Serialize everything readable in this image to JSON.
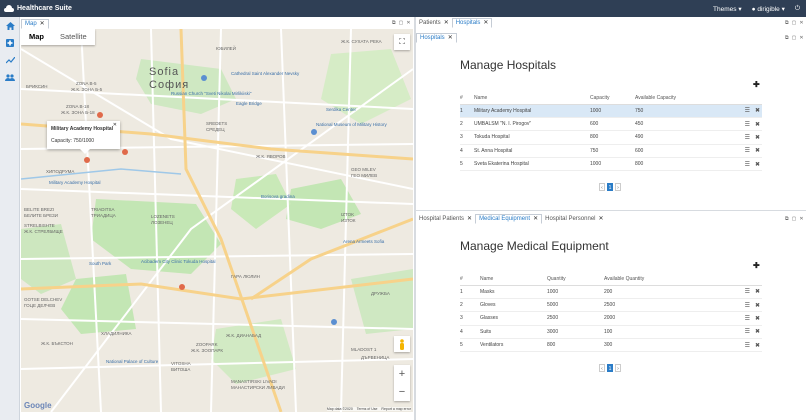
{
  "app": {
    "title": "Healthcare Suite",
    "themes": "Themes",
    "user": "dirigible"
  },
  "sidebar": {
    "icons": [
      "home-icon",
      "hospital-icon",
      "chart-icon",
      "people-icon"
    ]
  },
  "map_tabs": [
    {
      "label": "Map"
    }
  ],
  "map": {
    "type_buttons": [
      "Map",
      "Satellite"
    ],
    "info_title": "Military Academy Hospital",
    "info_capacity": "Capacity: 750/1000",
    "city_latin": "Sofia",
    "city_cyr": "София",
    "google": "Google",
    "attr": [
      "Map data ©2020",
      "Terms of Use",
      "Report a map error"
    ],
    "labels": [
      {
        "t": "ZONA B-5"
      },
      {
        "t": "Ж.К. ЗОНА Б-5"
      },
      {
        "t": "ZONA B-18"
      },
      {
        "t": "Ж.К. ЗОНА Б-18"
      },
      {
        "t": "ЮБИЛЕЙ"
      },
      {
        "t": "SREDETS"
      },
      {
        "t": "СРЕДЕЦ"
      },
      {
        "t": "IZTOK"
      },
      {
        "t": "ИЗТОК"
      },
      {
        "t": "LOZENETS"
      },
      {
        "t": "ЛОЗЕНЕЦ"
      },
      {
        "t": "ГАРА ЛЮЛИН"
      },
      {
        "t": "TRIADITSA"
      },
      {
        "t": "ТРИАДИЦА"
      },
      {
        "t": "STRELBISHTE"
      },
      {
        "t": "Ж.К. СТРЕЛБИЩЕ"
      },
      {
        "t": "GOTSE DELCHEV"
      },
      {
        "t": "ГОЦЕ ДЕЛЧЕВ"
      },
      {
        "t": "Ж.К. ДИАНАБАД"
      },
      {
        "t": "ZOOPARK"
      },
      {
        "t": "Ж.К. ЗООПАРК"
      },
      {
        "t": "VITOSHA"
      },
      {
        "t": "ВИТОША"
      },
      {
        "t": "MANASTIRSKI LIVADI"
      },
      {
        "t": "МАНАСТИРСКИ ЛИВАДИ"
      },
      {
        "t": "MLADOST 1"
      },
      {
        "t": "GEO MILEV"
      },
      {
        "t": "ГЕО МИЛЕВ"
      },
      {
        "t": "Ж.К. СУХАТА РЕКА"
      },
      {
        "t": "Ж.К. ЯВОРОВ"
      },
      {
        "t": "BELITE BREZI"
      },
      {
        "t": "БЕЛИТЕ БРЕЗИ"
      },
      {
        "t": "ХИПОДРУМА"
      },
      {
        "t": "БРИКСИН"
      },
      {
        "t": "ДРУЖБА"
      },
      {
        "t": "Ж.К. БЪКСТОН"
      },
      {
        "t": "ХЛАДИЛНИКА"
      },
      {
        "t": "ДЪРВЕНИЦА"
      }
    ],
    "pois": [
      {
        "t": "Cathedral Saint Alexander Nevsky"
      },
      {
        "t": "Russian Church \"Sveti Nikolai Mirlikiiski\""
      },
      {
        "t": "Eagle Bridge"
      },
      {
        "t": "Serdika Center"
      },
      {
        "t": "National Museum of Military History"
      },
      {
        "t": "Borisova gradina"
      },
      {
        "t": "Arena Armeets Sofia"
      },
      {
        "t": "Acibadem City Clinic Tokuda Hospital"
      },
      {
        "t": "South Park"
      },
      {
        "t": "National Palace of Culture"
      },
      {
        "t": "Military Academy Hospital"
      }
    ]
  },
  "hospitals_tabs": [
    {
      "label": "Patients"
    },
    {
      "label": "Hospitals"
    }
  ],
  "hospitals_subtabs": [
    {
      "label": "Hospitals"
    }
  ],
  "hospitals": {
    "title": "Manage Hospitals",
    "columns": [
      "#",
      "Name",
      "Capacity",
      "Available Capacity"
    ],
    "rows": [
      [
        "1",
        "Military Academy Hospital",
        "1000",
        "750"
      ],
      [
        "2",
        "UMBALSM \"N. I. Pirogov\"",
        "600",
        "450"
      ],
      [
        "3",
        "Tokuda Hospital",
        "800",
        "490"
      ],
      [
        "4",
        "St. Anna Hospital",
        "750",
        "600"
      ],
      [
        "5",
        "Sveta Ekaterina Hospital",
        "1000",
        "800"
      ]
    ],
    "page": "1"
  },
  "equipment_tabs": [
    {
      "label": "Hospital Patients"
    },
    {
      "label": "Medical Equipment"
    },
    {
      "label": "Hospital Personnel"
    }
  ],
  "equipment": {
    "title": "Manage Medical Equipment",
    "columns": [
      "#",
      "Name",
      "Quantity",
      "Available Quantity"
    ],
    "rows": [
      [
        "1",
        "Masks",
        "1000",
        "200"
      ],
      [
        "2",
        "Gloves",
        "5000",
        "2500"
      ],
      [
        "3",
        "Glasses",
        "2500",
        "2000"
      ],
      [
        "4",
        "Suits",
        "3000",
        "100"
      ],
      [
        "5",
        "Ventilators",
        "800",
        "300"
      ]
    ],
    "page": "1"
  },
  "colors": {
    "topbar": "#2f3f55",
    "accent": "#2a7cc7",
    "selected_row": "#d9e8f6",
    "park": "#c3e6b4",
    "road": "#ffffff",
    "highway": "#f7d28a"
  }
}
